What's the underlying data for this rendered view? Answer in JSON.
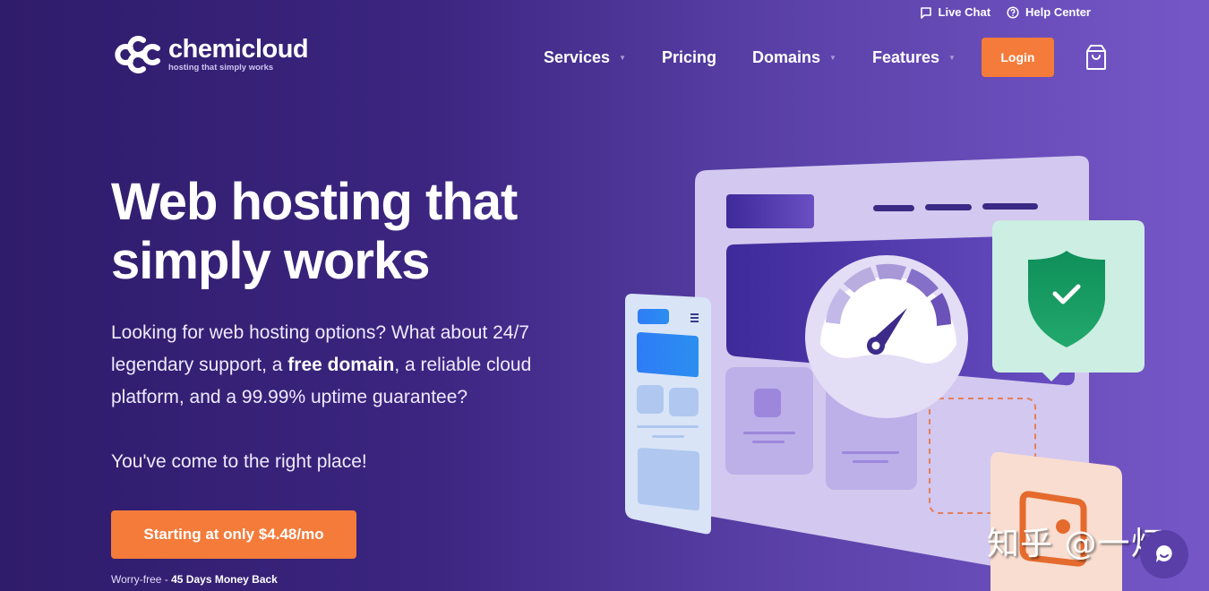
{
  "topbar": {
    "live_chat": "Live Chat",
    "help_center": "Help Center"
  },
  "brand": {
    "name": "chemicloud",
    "tagline": "hosting that simply works"
  },
  "nav": {
    "items": [
      {
        "label": "Services",
        "has_dropdown": true
      },
      {
        "label": "Pricing",
        "has_dropdown": false
      },
      {
        "label": "Domains",
        "has_dropdown": true
      },
      {
        "label": "Features",
        "has_dropdown": true
      }
    ],
    "login_label": "Login",
    "cart_icon": "shopping-bag-icon"
  },
  "hero": {
    "title_line1": "Web hosting that",
    "title_line2": "simply works",
    "desc_part1": "Looking for web hosting options? What about 24/7 legendary support, a ",
    "desc_bold": "free domain",
    "desc_part2": ", a reliable cloud platform, and a 99.99% uptime guarantee?",
    "desc2": "You've come to the right place!",
    "cta_label": "Starting at only $4.48/mo",
    "guarantee_prefix": "Worry-free - ",
    "guarantee_bold": "45 Days Money Back"
  },
  "watermark": "知乎 @一灯",
  "colors": {
    "accent": "#f47b3a",
    "bg_start": "#2f1c6a",
    "bg_end": "#7657c8",
    "shield": "#1e9c63"
  }
}
